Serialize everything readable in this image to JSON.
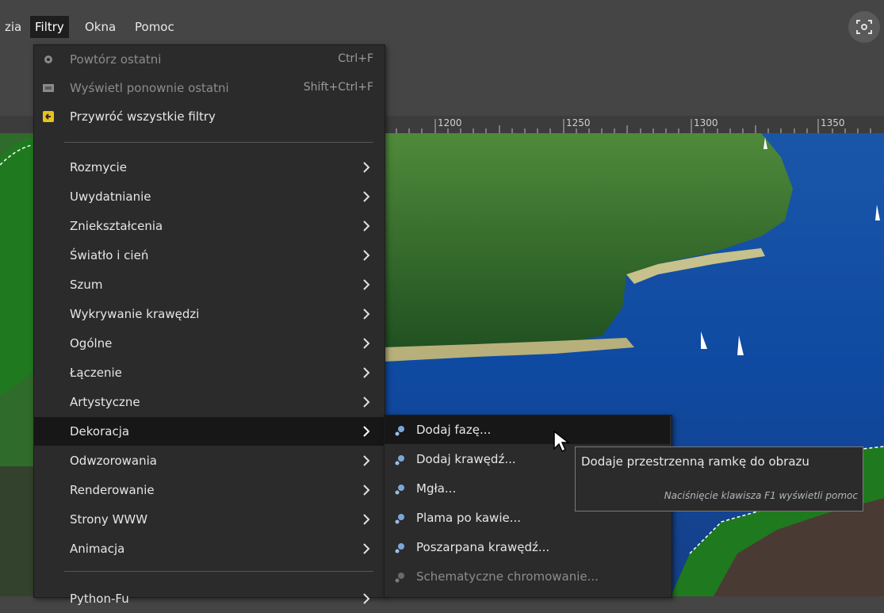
{
  "menubar": {
    "items": [
      {
        "label": "zia"
      },
      {
        "label": "Filtry"
      },
      {
        "label": "Okna"
      },
      {
        "label": "Pomoc"
      }
    ]
  },
  "ruler": {
    "labels": [
      "1200",
      "1250",
      "1300",
      "1350"
    ]
  },
  "filters_menu": {
    "top_items": [
      {
        "label": "Powtórz ostatni",
        "shortcut": "Ctrl+F",
        "icon": "gear-icon"
      },
      {
        "label": "Wyświetl ponownie ostatni",
        "shortcut": "Shift+Ctrl+F",
        "icon": "gears-icon"
      },
      {
        "label": "Przywróć wszystkie filtry",
        "shortcut": "",
        "icon": "reset-icon"
      }
    ],
    "categories": [
      {
        "label": "Rozmycie"
      },
      {
        "label": "Uwydatnianie"
      },
      {
        "label": "Zniekształcenia"
      },
      {
        "label": "Światło i cień"
      },
      {
        "label": "Szum"
      },
      {
        "label": "Wykrywanie krawędzi"
      },
      {
        "label": "Ogólne"
      },
      {
        "label": "Łączenie"
      },
      {
        "label": "Artystyczne"
      },
      {
        "label": "Dekoracja"
      },
      {
        "label": "Odwzorowania"
      },
      {
        "label": "Renderowanie"
      },
      {
        "label": "Strony WWW"
      },
      {
        "label": "Animacja"
      }
    ],
    "bottom_items": [
      {
        "label": "Python-Fu"
      }
    ]
  },
  "decoration_submenu": {
    "items": [
      {
        "label": "Dodaj fazę..."
      },
      {
        "label": "Dodaj krawędź..."
      },
      {
        "label": "Mgła..."
      },
      {
        "label": "Plama po kawie..."
      },
      {
        "label": "Poszarpana krawędź..."
      },
      {
        "label": "Schematyczne chromowanie..."
      }
    ]
  },
  "tooltip": {
    "text": "Dodaje przestrzenną ramkę do obrazu",
    "hint": "Naciśnięcie klawisza F1 wyświetli pomoc"
  },
  "colors": {
    "menu_bg": "#2b2b2b",
    "highlight": "#171717",
    "chrome": "#454545",
    "water": "#1453a8",
    "forest": "#2f6b2a",
    "selection": "#1f7a1f"
  }
}
